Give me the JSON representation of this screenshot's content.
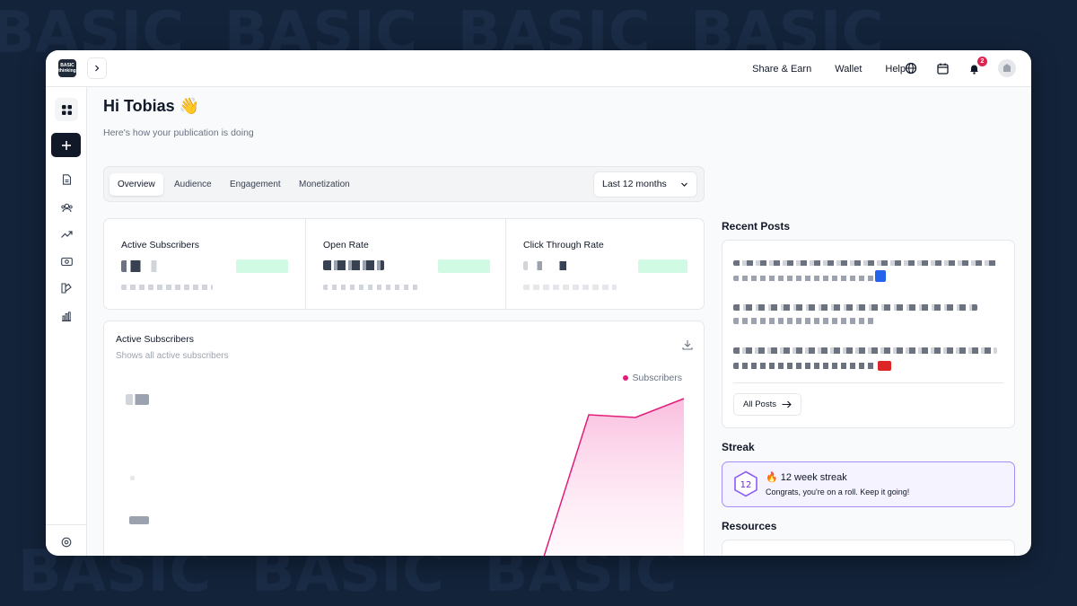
{
  "header": {
    "logo_text": "BASIC thinking",
    "nav": [
      {
        "label": "Share & Earn"
      },
      {
        "label": "Wallet"
      },
      {
        "label": "Help"
      }
    ],
    "notifications_count": "2"
  },
  "main": {
    "greeting": "Hi Tobias 👋",
    "subtitle": "Here's how your publication is doing",
    "tabs": [
      {
        "label": "Overview",
        "active": true
      },
      {
        "label": "Audience",
        "active": false
      },
      {
        "label": "Engagement",
        "active": false
      },
      {
        "label": "Monetization",
        "active": false
      }
    ],
    "date_range": "Last 12 months",
    "stats": [
      {
        "label": "Active Subscribers"
      },
      {
        "label": "Open Rate"
      },
      {
        "label": "Click Through Rate"
      }
    ],
    "chart": {
      "title": "Active Subscribers",
      "subtitle": "Shows all active subscribers"
    }
  },
  "chart_data": {
    "type": "area",
    "title": "Active Subscribers",
    "subtitle": "Shows all active subscribers",
    "series": [
      {
        "name": "Subscribers",
        "color": "#e11d78"
      }
    ],
    "legend": "top-right",
    "grid": false
  },
  "side": {
    "recent_posts_heading": "Recent Posts",
    "all_posts_label": "All Posts",
    "streak_heading": "Streak",
    "streak": {
      "count": "12",
      "emoji": "🔥",
      "title": "12 week streak",
      "message": "Congrats, you're on a roll. Keep it going!"
    },
    "resources_heading": "Resources"
  },
  "colors": {
    "accent": "#e11d78",
    "streak_border": "#a78bfa",
    "streak_bg": "#f5f3ff",
    "badge": "#dc2650"
  }
}
